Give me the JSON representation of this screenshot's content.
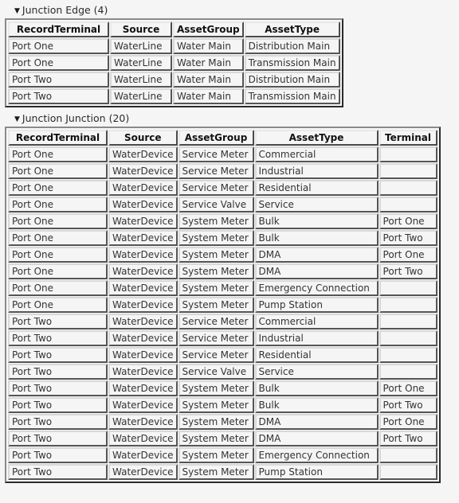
{
  "colors": {
    "page_background": "#f5f5f5",
    "cell_background": "#f5f5f5",
    "border_dark": "#2b2b2b",
    "border_light": "#d8d8d8",
    "text": "#333333",
    "header_text": "#111111"
  },
  "icons": {
    "collapse_triangle": "▼"
  },
  "sections": [
    {
      "title": "Junction Edge (4)",
      "count": 4,
      "columns": [
        "RecordTerminal",
        "Source",
        "AssetGroup",
        "AssetType"
      ],
      "rows": [
        [
          "Port One",
          "WaterLine",
          "Water Main",
          "Distribution Main"
        ],
        [
          "Port One",
          "WaterLine",
          "Water Main",
          "Transmission Main"
        ],
        [
          "Port Two",
          "WaterLine",
          "Water Main",
          "Distribution Main"
        ],
        [
          "Port Two",
          "WaterLine",
          "Water Main",
          "Transmission Main"
        ]
      ]
    },
    {
      "title": "Junction Junction (20)",
      "count": 20,
      "columns": [
        "RecordTerminal",
        "Source",
        "AssetGroup",
        "AssetType",
        "Terminal"
      ],
      "rows": [
        [
          "Port One",
          "WaterDevice",
          "Service Meter",
          "Commercial",
          ""
        ],
        [
          "Port One",
          "WaterDevice",
          "Service Meter",
          "Industrial",
          ""
        ],
        [
          "Port One",
          "WaterDevice",
          "Service Meter",
          "Residential",
          ""
        ],
        [
          "Port One",
          "WaterDevice",
          "Service Valve",
          "Service",
          ""
        ],
        [
          "Port One",
          "WaterDevice",
          "System Meter",
          "Bulk",
          "Port One"
        ],
        [
          "Port One",
          "WaterDevice",
          "System Meter",
          "Bulk",
          "Port Two"
        ],
        [
          "Port One",
          "WaterDevice",
          "System Meter",
          "DMA",
          "Port One"
        ],
        [
          "Port One",
          "WaterDevice",
          "System Meter",
          "DMA",
          "Port Two"
        ],
        [
          "Port One",
          "WaterDevice",
          "System Meter",
          "Emergency Connection",
          ""
        ],
        [
          "Port One",
          "WaterDevice",
          "System Meter",
          "Pump Station",
          ""
        ],
        [
          "Port Two",
          "WaterDevice",
          "Service Meter",
          "Commercial",
          ""
        ],
        [
          "Port Two",
          "WaterDevice",
          "Service Meter",
          "Industrial",
          ""
        ],
        [
          "Port Two",
          "WaterDevice",
          "Service Meter",
          "Residential",
          ""
        ],
        [
          "Port Two",
          "WaterDevice",
          "Service Valve",
          "Service",
          ""
        ],
        [
          "Port Two",
          "WaterDevice",
          "System Meter",
          "Bulk",
          "Port One"
        ],
        [
          "Port Two",
          "WaterDevice",
          "System Meter",
          "Bulk",
          "Port Two"
        ],
        [
          "Port Two",
          "WaterDevice",
          "System Meter",
          "DMA",
          "Port One"
        ],
        [
          "Port Two",
          "WaterDevice",
          "System Meter",
          "DMA",
          "Port Two"
        ],
        [
          "Port Two",
          "WaterDevice",
          "System Meter",
          "Emergency Connection",
          ""
        ],
        [
          "Port Two",
          "WaterDevice",
          "System Meter",
          "Pump Station",
          ""
        ]
      ]
    }
  ]
}
